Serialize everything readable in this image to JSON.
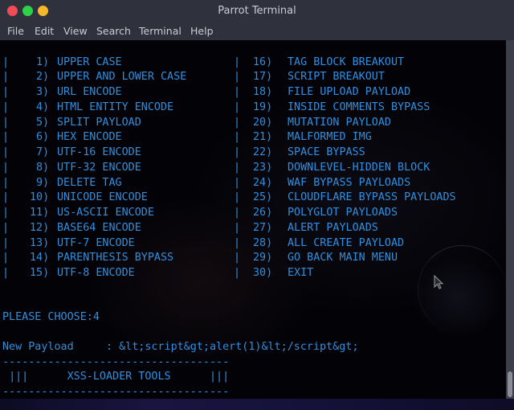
{
  "window": {
    "title": "Parrot Terminal",
    "controls": {
      "close_color": "#f14c56",
      "maximize_color": "#2ed24a",
      "minimize_color": "#f6b828"
    }
  },
  "menubar": {
    "items": [
      "File",
      "Edit",
      "View",
      "Search",
      "Terminal",
      "Help"
    ]
  },
  "terminal": {
    "text_color": "#2f8fe0",
    "menu_left": [
      {
        "num": "1)",
        "label": "UPPER CASE"
      },
      {
        "num": "2)",
        "label": "UPPER AND LOWER CASE"
      },
      {
        "num": "3)",
        "label": "URL ENCODE"
      },
      {
        "num": "4)",
        "label": "HTML ENTITY ENCODE"
      },
      {
        "num": "5)",
        "label": "SPLIT PAYLOAD"
      },
      {
        "num": "6)",
        "label": "HEX ENCODE"
      },
      {
        "num": "7)",
        "label": "UTF-16 ENCODE"
      },
      {
        "num": "8)",
        "label": "UTF-32 ENCODE"
      },
      {
        "num": "9)",
        "label": "DELETE TAG"
      },
      {
        "num": "10)",
        "label": "UNICODE ENCODE"
      },
      {
        "num": "11)",
        "label": "US-ASCII ENCODE"
      },
      {
        "num": "12)",
        "label": "BASE64 ENCODE"
      },
      {
        "num": "13)",
        "label": "UTF-7 ENCODE"
      },
      {
        "num": "14)",
        "label": "PARENTHESIS BYPASS"
      },
      {
        "num": "15)",
        "label": "UTF-8 ENCODE"
      }
    ],
    "menu_right": [
      {
        "num": "16)",
        "label": "TAG BLOCK BREAKOUT"
      },
      {
        "num": "17)",
        "label": "SCRIPT BREAKOUT"
      },
      {
        "num": "18)",
        "label": "FILE UPLOAD PAYLOAD"
      },
      {
        "num": "19)",
        "label": "INSIDE COMMENTS BYPASS"
      },
      {
        "num": "20)",
        "label": "MUTATION PAYLOAD"
      },
      {
        "num": "21)",
        "label": "MALFORMED IMG"
      },
      {
        "num": "22)",
        "label": "SPACE BYPASS"
      },
      {
        "num": "23)",
        "label": "DOWNLEVEL-HIDDEN BLOCK"
      },
      {
        "num": "24)",
        "label": "WAF BYPASS PAYLOADS"
      },
      {
        "num": "25)",
        "label": "CLOUDFLARE BYPASS PAYLOADS"
      },
      {
        "num": "26)",
        "label": "POLYGLOT PAYLOADS"
      },
      {
        "num": "27)",
        "label": "ALERT PAYLOADS"
      },
      {
        "num": "28)",
        "label": "ALL CREATE PAYLOAD"
      },
      {
        "num": "29)",
        "label": "GO BACK MAIN MENU"
      },
      {
        "num": "30)",
        "label": "EXIT"
      }
    ],
    "border_char": "|",
    "prompt_label": "PLEASE CHOOSE:",
    "prompt_value": "4",
    "payload_label": "New Payload",
    "payload_sep": ":",
    "payload_value": "&lt;script&gt;alert(1)&lt;/script&gt;",
    "banner_rule": "-----------------------------------",
    "banner_left": "|||",
    "banner_title": "XSS-LOADER TOOLS",
    "banner_right": "|||"
  },
  "scrollbar": {
    "position_fraction": 1.0
  }
}
